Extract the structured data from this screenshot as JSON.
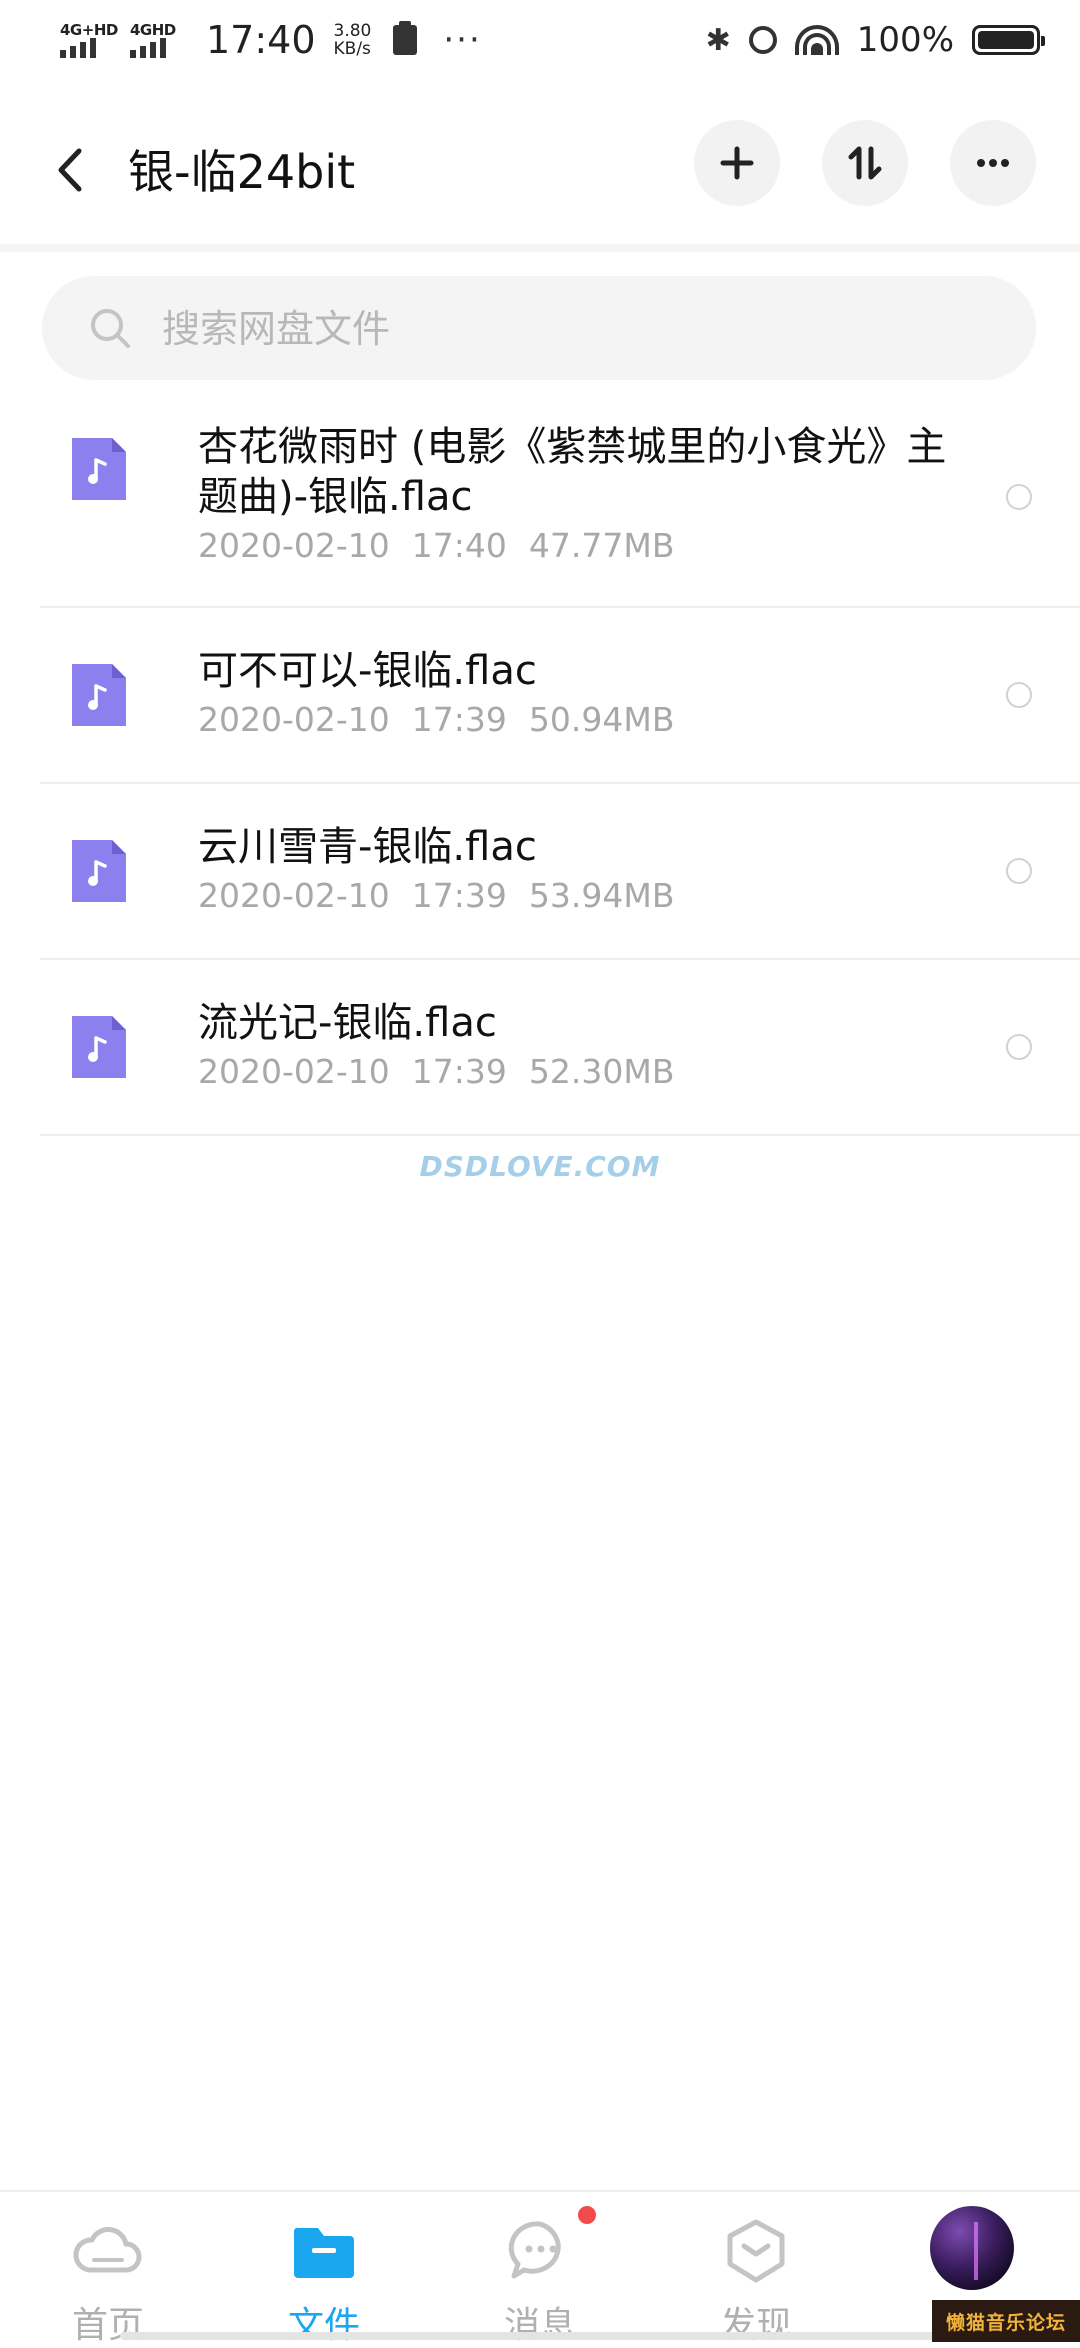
{
  "status_bar": {
    "network1": "4G+HD",
    "network2": "4GHD",
    "time": "17:40",
    "speed_value": "3.80",
    "speed_unit": "KB/s",
    "more": "···",
    "battery": "100%"
  },
  "header": {
    "title": "银-临24bit",
    "icons": [
      "back-icon",
      "plus-icon",
      "sort-icon",
      "more-icon"
    ]
  },
  "search": {
    "placeholder": "搜索网盘文件"
  },
  "files": [
    {
      "name": "杏花微雨时 (电影《紫禁城里的小食光》主题曲)-银临.flac",
      "date": "2020-02-10",
      "time": "17:40",
      "size": "47.77MB"
    },
    {
      "name": "可不可以-银临.flac",
      "date": "2020-02-10",
      "time": "17:39",
      "size": "50.94MB"
    },
    {
      "name": "云川雪青-银临.flac",
      "date": "2020-02-10",
      "time": "17:39",
      "size": "53.94MB"
    },
    {
      "name": "流光记-银临.flac",
      "date": "2020-02-10",
      "time": "17:39",
      "size": "52.30MB"
    }
  ],
  "watermark": "DSDLOVE.COM",
  "bottom_nav": {
    "tabs": [
      {
        "label": "首页",
        "icon": "cloud-icon"
      },
      {
        "label": "文件",
        "icon": "folder-icon"
      },
      {
        "label": "消息",
        "icon": "chat-icon"
      },
      {
        "label": "发现",
        "icon": "discover-icon"
      }
    ],
    "active_tab": "文件",
    "badge": "懒猫音乐论坛"
  },
  "colors": {
    "accent": "#1aa7f0",
    "file_icon": "#8b80ee",
    "badge_red": "#f24b4b",
    "muted_text": "#a8a8a8"
  }
}
